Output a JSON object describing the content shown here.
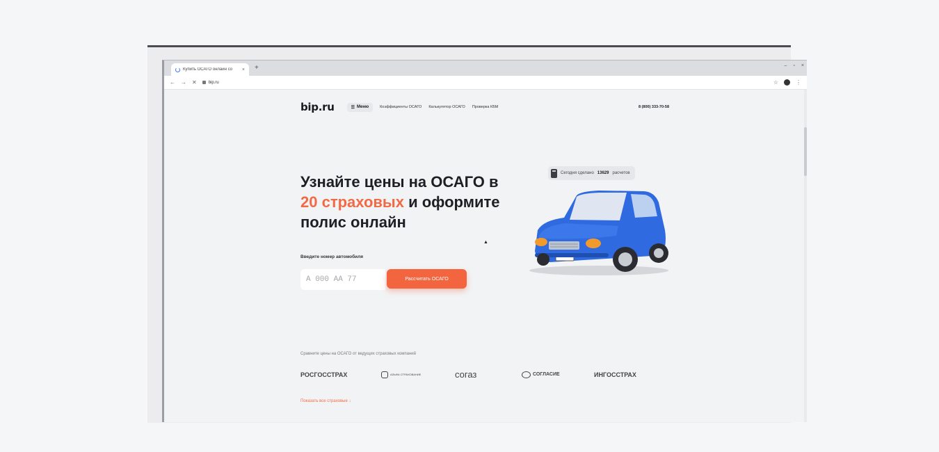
{
  "browser": {
    "tab_title": "Купить ОСАГО онлайн со",
    "tab_close": "×",
    "new_tab": "+",
    "window_controls": [
      "–",
      "▫",
      "×"
    ],
    "back": "←",
    "forward": "→",
    "stop": "✕",
    "url": "bip.ru",
    "star": "☆",
    "more": "⋮"
  },
  "site": {
    "logo": "bip.ru",
    "menu_icon": "☰",
    "menu_label": "Меню",
    "nav": [
      "Коэффициенты ОСАГО",
      "Калькулятор ОСАГО",
      "Проверка КБМ"
    ],
    "phone": "8 (800) 333-70-58",
    "headline": {
      "line1": "Узнайте цены на ОСАГО в",
      "accent": "20 страховых",
      "line2_rest": " и оформите",
      "line3": "полис онлайн"
    },
    "plate_label": "Введите номер автомобиля",
    "plate_placeholder": "А 000 АА 77",
    "calc_button": "Рассчитать ОСАГО",
    "counter": {
      "prefix": "Сегодня сделано",
      "count": "13629",
      "suffix": "расчетов"
    },
    "compare_text": "Сравните цены на ОСАГО от ведущих страховых компаний",
    "insurers": [
      "РОСГОССТРАХ",
      "АЛЬФА СТРАХОВАНИЕ",
      "согаз",
      "СОГЛАСИЕ",
      "ИНГОССТРАХ"
    ],
    "show_all": "Показать все страховые ↓"
  },
  "colors": {
    "accent": "#f26a45",
    "car_body": "#2f6ae0"
  }
}
